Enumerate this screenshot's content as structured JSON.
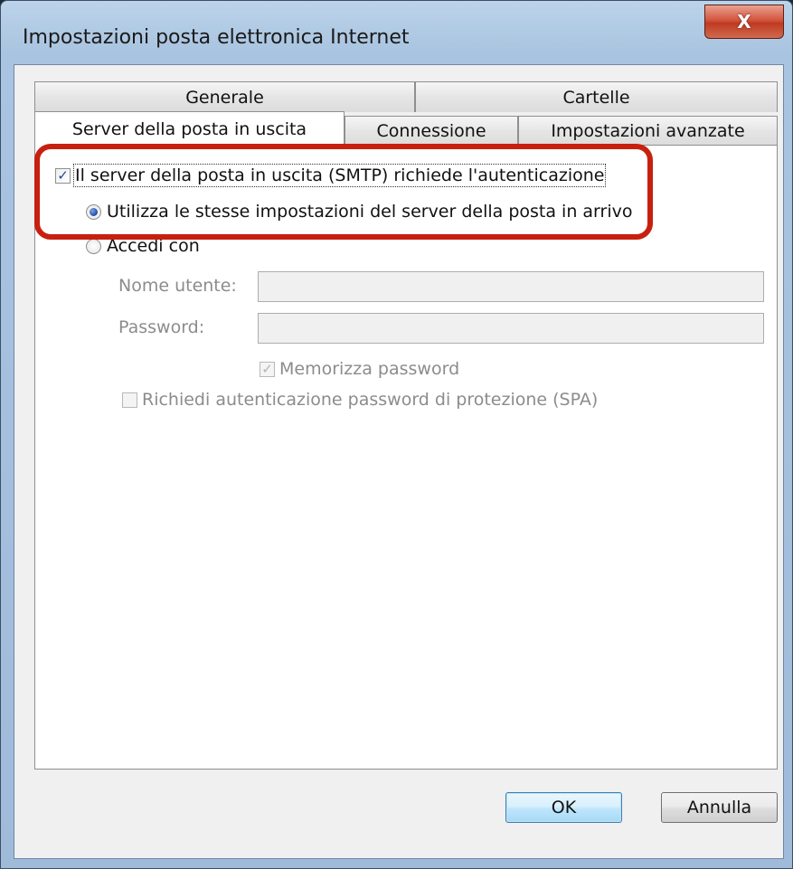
{
  "window": {
    "title": "Impostazioni posta elettronica Internet",
    "close_label": "X"
  },
  "tabs": {
    "row1": [
      "Generale",
      "Cartelle"
    ],
    "row2": [
      "Server della posta in uscita",
      "Connessione",
      "Impostazioni avanzate"
    ],
    "active": "Server della posta in uscita"
  },
  "smtp": {
    "auth_required_label": "Il server della posta in uscita (SMTP) richiede l'autenticazione",
    "auth_required_checked": true,
    "use_incoming_settings_label": "Utilizza le stesse impostazioni del server della posta in arrivo",
    "use_incoming_settings_selected": true,
    "login_with_label": "Accedi con",
    "login_with_selected": false
  },
  "credentials": {
    "username_label": "Nome utente:",
    "username_value": "",
    "password_label": "Password:",
    "password_value": "",
    "remember_password_label": "Memorizza password",
    "remember_password_checked": true,
    "spa_label": "Richiedi autenticazione password di protezione (SPA)",
    "spa_checked": false
  },
  "buttons": {
    "ok_label": "OK",
    "cancel_label": "Annulla"
  },
  "colors": {
    "highlight": "#c8200f",
    "close_button": "#c03a22",
    "default_button_border": "#3c7fb1"
  }
}
